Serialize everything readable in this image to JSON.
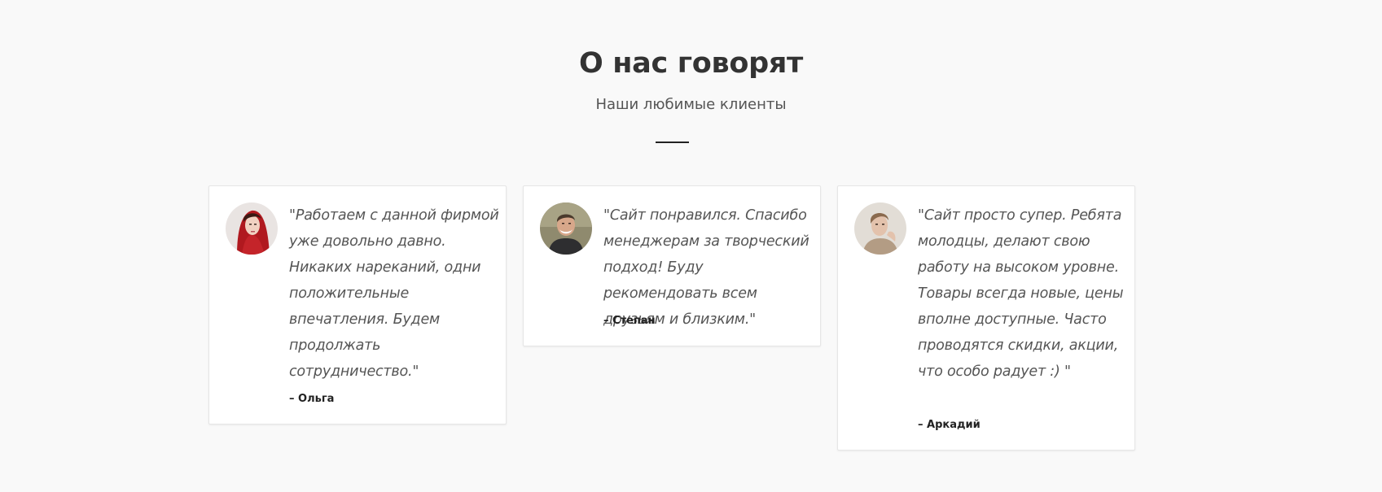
{
  "header": {
    "title": "О нас говорят",
    "subtitle": "Наши любимые клиенты"
  },
  "testimonials": [
    {
      "quote": "\"Работаем с данной фирмой уже довольно давно. Никаких нареканий, одни положительные впечатления. Будем продолжать сотрудничество.\"",
      "author": "– Ольга",
      "avatar_icon": "woman-red-scarf-avatar"
    },
    {
      "quote": "\"Сайт понравился. Спасибо менеджерам за творческий подход! Буду рекомендовать всем друзьям и близким.\"",
      "author": "– Степан",
      "avatar_icon": "smiling-man-avatar"
    },
    {
      "quote": "\"Сайт просто супер. Ребята молодцы, делают свою работу на высоком уровне. Товары всегда новые, цены вполне доступные. Часто проводятся скидки, акции, что особо радует :) \"",
      "author": "– Аркадий",
      "avatar_icon": "young-man-avatar"
    }
  ],
  "colors": {
    "background": "#f9f9f9",
    "card": "#ffffff",
    "text": "#333333",
    "quote_text": "#555555"
  }
}
